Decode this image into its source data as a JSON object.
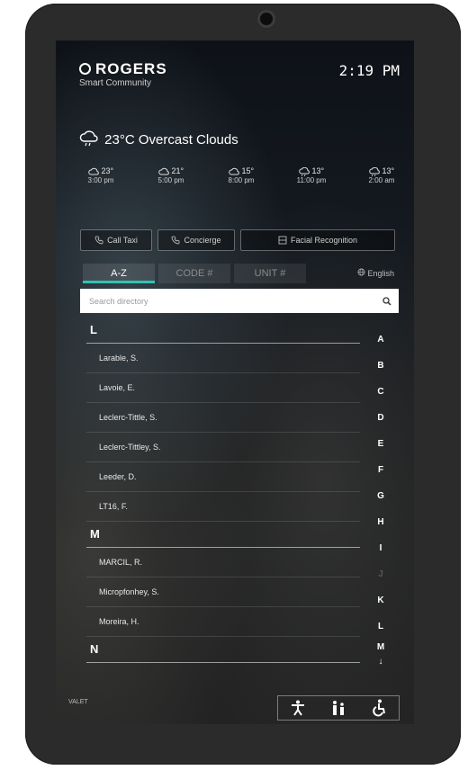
{
  "header": {
    "brand": "ROGERS",
    "subtitle": "Smart Community",
    "time": "2:19 PM"
  },
  "weather": {
    "current_temp": "23°C",
    "condition": "Overcast Clouds",
    "forecast": [
      {
        "temp": "23°",
        "time": "3:00 pm",
        "icon": "partly-cloudy-icon"
      },
      {
        "temp": "21°",
        "time": "5:00 pm",
        "icon": "partly-cloudy-icon"
      },
      {
        "temp": "15°",
        "time": "8:00 pm",
        "icon": "partly-cloudy-icon"
      },
      {
        "temp": "13°",
        "time": "11:00 pm",
        "icon": "rain-cloud-icon"
      },
      {
        "temp": "13°",
        "time": "2:00 am",
        "icon": "rain-cloud-icon"
      }
    ]
  },
  "actions": {
    "call_taxi": "Call Taxi",
    "concierge": "Concierge",
    "facial_recognition": "Facial Recognition"
  },
  "tabs": {
    "az": "A-Z",
    "code": "CODE #",
    "unit": "UNIT #"
  },
  "language": "English",
  "search": {
    "placeholder": "Search directory"
  },
  "directory": {
    "sections": [
      {
        "letter": "L",
        "entries": [
          "Larable, S.",
          "Lavoie, E.",
          "Leclerc-Tittle, S.",
          "Leclerc-Tittley, S.",
          "Leeder, D.",
          "LT16, F."
        ]
      },
      {
        "letter": "M",
        "entries": [
          "MARCIL, R.",
          "Micropfonhey, S.",
          "Moreira, H."
        ]
      },
      {
        "letter": "N",
        "entries": []
      }
    ]
  },
  "index_letters": [
    "A",
    "B",
    "C",
    "D",
    "E",
    "F",
    "G",
    "H",
    "I",
    "J",
    "K",
    "L",
    "M"
  ],
  "index_more": "↓",
  "footer": {
    "valet": "VALET"
  },
  "colors": {
    "accent": "#2ec4b6"
  }
}
